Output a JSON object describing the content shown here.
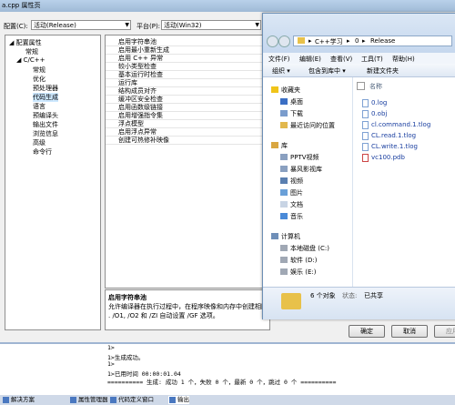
{
  "window": {
    "title": "a.cpp 属性页"
  },
  "toolbar": {
    "config_label": "配置(C):",
    "config_value": "活动(Release)",
    "platform_label": "平台(P):",
    "platform_value": "活动(Win32)"
  },
  "tree": {
    "items": [
      "配置属性",
      "常规",
      "C/C++",
      "常规",
      "优化",
      "预处理器",
      "代码生成",
      "语言",
      "预编译头",
      "输出文件",
      "浏览信息",
      "高级",
      "命令行"
    ]
  },
  "grid": {
    "rows": [
      "启用字符串池",
      "启用最小重新生成",
      "启用 C++ 异常",
      "较小类型检查",
      "基本运行时检查",
      "运行库",
      "结构成员对齐",
      "缓冲区安全检查",
      "启用函数级链接",
      "启用增强指令集",
      "浮点模型",
      "启用浮点异常",
      "创建可热修补映像"
    ]
  },
  "description": {
    "title": "启用字符串池",
    "text1": "允许编译器在执行过程中，在程序映像和内存中创建相同",
    "text2": ". /O1, /O2 和 /ZI 自动设置 /GF 选项。"
  },
  "buttons": {
    "ok": "确定",
    "cancel": "取消",
    "apply": "应用"
  },
  "explorer": {
    "breadcrumb": [
      "C++学习",
      "0",
      "Release"
    ],
    "menu": [
      "文件(F)",
      "编辑(E)",
      "查看(V)",
      "工具(T)",
      "帮助(H)"
    ],
    "tools": [
      "组织",
      "包含到库中",
      "新建文件夹"
    ],
    "nav": {
      "favorites": "收藏夹",
      "fav_items": [
        "桌面",
        "下载",
        "最近访问的位置"
      ],
      "libraries": "库",
      "lib_items": [
        "PPTV视频",
        "暴风影视库",
        "视频",
        "图片",
        "文档",
        "音乐"
      ],
      "computer": "计算机",
      "comp_items": [
        "本地磁盘 (C:)",
        "软件 (D:)",
        "娱乐 (E:)"
      ]
    },
    "column": "名称",
    "files": [
      "0.log",
      "0.obj",
      "cl.command.1.tlog",
      "CL.read.1.tlog",
      "CL.write.1.tlog",
      "vc100.pdb"
    ],
    "status_count": "6 个对象",
    "status_state": "状态:",
    "status_share": "已共享"
  },
  "output": {
    "lines": [
      "1>",
      "1>生成成功。",
      "1>",
      "1>已用时间 00:00:01.04",
      "========== 生成: 成功 1 个，失败 0 个，最新 0 个，跳过 0 个 =========="
    ]
  },
  "bottom_tabs": [
    "解决方案",
    "属性管理器",
    "代码定义窗口",
    "输出"
  ]
}
